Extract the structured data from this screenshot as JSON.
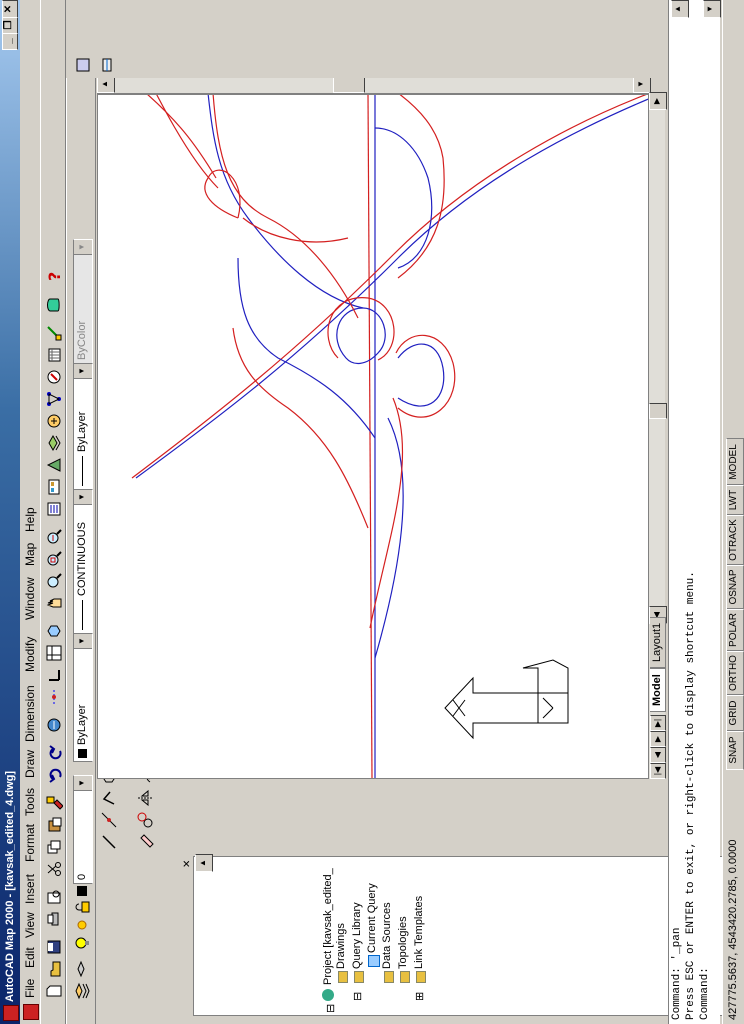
{
  "window": {
    "title": "AutoCAD Map 2000 - [kavsak_edited_4.dwg]",
    "min_label": "_",
    "restore_label": "❒",
    "close_label": "✕"
  },
  "menu": {
    "items": [
      "File",
      "Edit",
      "View",
      "Insert",
      "Format",
      "Tools",
      "Draw",
      "Dimension",
      "Modify",
      "Window",
      "Map",
      "Help"
    ]
  },
  "layer_toolbar": {
    "layer_value": "0",
    "color_value": "ByLayer",
    "linetype_value": "CONTINUOUS",
    "lineweight_value": "ByLayer",
    "plotstyle_value": "ByColor"
  },
  "project_tree": {
    "items": [
      {
        "label": "Project [kavsak_edited_",
        "level": 0
      },
      {
        "label": "Drawings",
        "level": 1
      },
      {
        "label": "Query Library",
        "level": 1
      },
      {
        "label": "Current Query",
        "level": 2
      },
      {
        "label": "Data Sources",
        "level": 1
      },
      {
        "label": "Topologies",
        "level": 1
      },
      {
        "label": "Link Templates",
        "level": 1
      }
    ],
    "close_label": "✕"
  },
  "tabs": {
    "model": "Model",
    "layout": "Layout1"
  },
  "command": {
    "lines": [
      "Command: '_pan",
      "Press ESC or ENTER to exit, or right-click to display shortcut menu.",
      "Command:"
    ]
  },
  "status": {
    "coordinates": "427775.5637, 4543420.2785, 0.0000",
    "toggles": [
      "SNAP",
      "GRID",
      "ORTHO",
      "POLAR",
      "OSNAP",
      "OTRACK",
      "LWT",
      "MODEL"
    ]
  },
  "colors": {
    "road_red": "#d42020",
    "road_blue": "#2020c0",
    "title_dark": "#0a246a"
  },
  "icons": {
    "ucs": "ucs-icon",
    "help": "help-icon"
  }
}
